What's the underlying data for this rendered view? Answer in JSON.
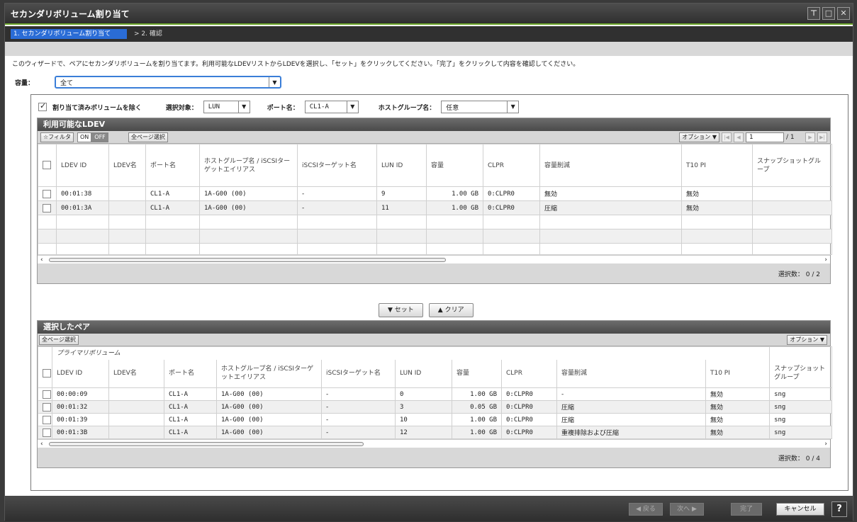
{
  "window": {
    "title": "セカンダリボリューム割り当て",
    "buttons": [
      "⊤",
      "□",
      "✕"
    ]
  },
  "steps": [
    {
      "label": "1. セカンダリボリューム割り当て"
    },
    {
      "label": "> 2. 確認"
    }
  ],
  "instruction": "このウィザードで、ペアにセカンダリボリュームを割り当てます。利用可能なLDEVリストからLDEVを選択し、「セット」をクリックしてください。「完了」をクリックして内容を確認してください。",
  "capacity": {
    "label": "容量：",
    "value": "全て"
  },
  "filter": {
    "exclude_label": "割り当て済みボリュームを除く",
    "target_label": "選択対象：",
    "target_value": "LUN",
    "port_label": "ポート名：",
    "port_value": "CL1-A",
    "hostgroup_label": "ホストグループ名：",
    "hostgroup_value": "任意"
  },
  "available": {
    "title": "利用可能なLDEV",
    "filter_btn": "☆フィルタ",
    "on": "ON",
    "off": "OFF",
    "select_all": "全ページ選択",
    "options": "オプション ▼",
    "page": "1",
    "page_total": "/ 1",
    "columns": [
      "LDEV ID",
      "LDEV名",
      "ポート名",
      "ホストグループ名 / iSCSIターゲットエイリアス",
      "iSCSIターゲット名",
      "LUN ID",
      "容量",
      "CLPR",
      "容量削減",
      "T10 PI",
      "スナップショットグループ"
    ],
    "rows": [
      [
        "00:01:38",
        "",
        "CL1-A",
        "1A-G00 (00)",
        "-",
        "9",
        "1.00 GB",
        "0:CLPR0",
        "無効",
        "無効",
        ""
      ],
      [
        "00:01:3A",
        "",
        "CL1-A",
        "1A-G00 (00)",
        "-",
        "11",
        "1.00 GB",
        "0:CLPR0",
        "圧縮",
        "無効",
        ""
      ]
    ],
    "selected_count": "選択数：  0   /   2"
  },
  "mid": {
    "set": "▼ セット",
    "clear": "▲ クリア"
  },
  "pairs": {
    "title": "選択したペア",
    "select_all": "全ページ選択",
    "options": "オプション ▼",
    "group_label": "プライマリボリューム",
    "columns": [
      "LDEV ID",
      "LDEV名",
      "ポート名",
      "ホストグループ名 / iSCSIターゲットエイリアス",
      "iSCSIターゲット名",
      "LUN ID",
      "容量",
      "CLPR",
      "容量削減",
      "T10 PI",
      "スナップショットグループ"
    ],
    "rows": [
      [
        "00:00:09",
        "",
        "CL1-A",
        "1A-G00 (00)",
        "-",
        "0",
        "1.00 GB",
        "0:CLPR0",
        "-",
        "無効",
        "sng"
      ],
      [
        "00:01:32",
        "",
        "CL1-A",
        "1A-G00 (00)",
        "-",
        "3",
        "0.05 GB",
        "0:CLPR0",
        "圧縮",
        "無効",
        "sng"
      ],
      [
        "00:01:39",
        "",
        "CL1-A",
        "1A-G00 (00)",
        "-",
        "10",
        "1.00 GB",
        "0:CLPR0",
        "圧縮",
        "無効",
        "sng"
      ],
      [
        "00:01:3B",
        "",
        "CL1-A",
        "1A-G00 (00)",
        "-",
        "12",
        "1.00 GB",
        "0:CLPR0",
        "重複排除および圧縮",
        "無効",
        "sng"
      ]
    ],
    "selected_count": "選択数：  0   /   4"
  },
  "footer": {
    "back": "◀ 戻る",
    "next": "次へ ▶",
    "finish": "完了",
    "cancel": "キャンセル",
    "help": "?"
  }
}
